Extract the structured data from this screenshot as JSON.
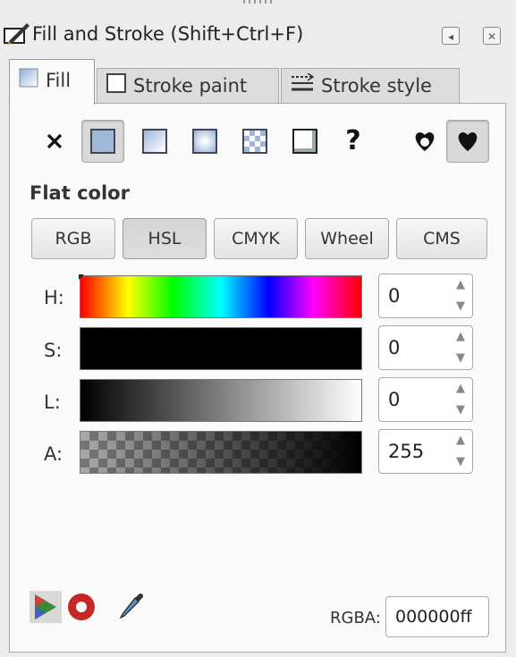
{
  "window": {
    "title": "Fill and Stroke (Shift+Ctrl+F)"
  },
  "tabs": [
    {
      "label": "Fill",
      "active": true,
      "icon": "fill-swatch-icon"
    },
    {
      "label": "Stroke paint",
      "active": false,
      "icon": "stroke-paint-icon"
    },
    {
      "label": "Stroke style",
      "active": false,
      "icon": "stroke-style-icon"
    }
  ],
  "paint_modes": [
    {
      "icon": "no-paint-icon",
      "selected": false
    },
    {
      "icon": "flat-color-icon",
      "selected": true
    },
    {
      "icon": "linear-gradient-icon",
      "selected": false
    },
    {
      "icon": "radial-gradient-icon",
      "selected": false
    },
    {
      "icon": "pattern-icon",
      "selected": false
    },
    {
      "icon": "swatch-icon",
      "selected": false
    },
    {
      "icon": "unset-paint-icon",
      "selected": false
    }
  ],
  "fill_rules": [
    {
      "icon": "fill-rule-evenodd-icon",
      "selected": false
    },
    {
      "icon": "fill-rule-nonzero-icon",
      "selected": true
    }
  ],
  "mode_label": "Flat color",
  "color_modes": [
    "RGB",
    "HSL",
    "CMYK",
    "Wheel",
    "CMS"
  ],
  "active_color_mode": "HSL",
  "channels": [
    {
      "label": "H:",
      "value": "0"
    },
    {
      "label": "S:",
      "value": "0"
    },
    {
      "label": "L:",
      "value": "0"
    },
    {
      "label": "A:",
      "value": "255"
    }
  ],
  "rgba": {
    "label": "RGBA:",
    "value": "000000ff"
  },
  "colors": {
    "panel_bg": "#fafafa",
    "accent_swatch": "#9fb8d8"
  }
}
